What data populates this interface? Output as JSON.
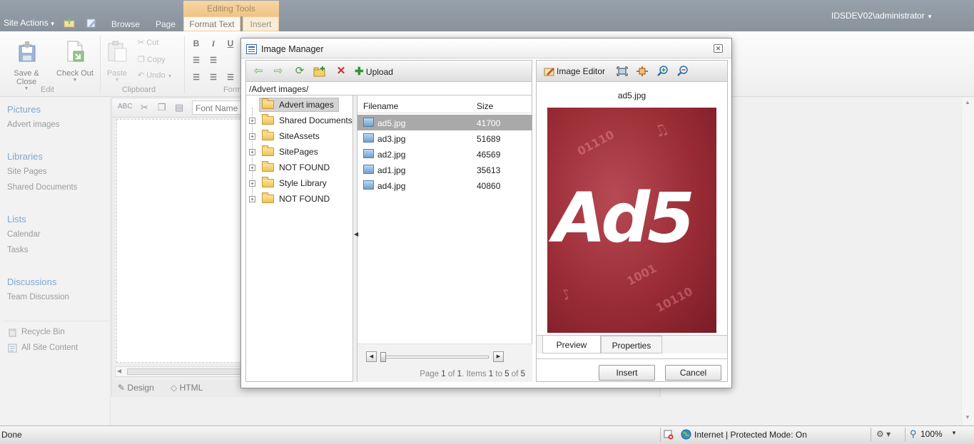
{
  "topbar": {
    "site_actions": "Site Actions",
    "tabs": {
      "browse": "Browse",
      "page": "Page",
      "format_text": "Format Text",
      "insert": "Insert"
    },
    "editing_tools": "Editing Tools",
    "user": "IDSDEV02\\administrator"
  },
  "ribbon": {
    "save_close": "Save & Close",
    "check_out": "Check Out",
    "edit_group": "Edit",
    "paste": "Paste",
    "cut": "Cut",
    "copy": "Copy",
    "undo": "Undo",
    "clipboard_group": "Clipboard",
    "format_group_partial": "Form",
    "bold": "B",
    "italic": "I",
    "underline": "U"
  },
  "leftnav": {
    "pictures": "Pictures",
    "advert_images": "Advert images",
    "libraries": "Libraries",
    "site_pages": "Site Pages",
    "shared_documents": "Shared Documents",
    "lists": "Lists",
    "calendar": "Calendar",
    "tasks": "Tasks",
    "discussions": "Discussions",
    "team_discussion": "Team Discussion",
    "recycle_bin": "Recycle Bin",
    "all_site_content": "All Site Content"
  },
  "editor": {
    "font_name": "Font Name",
    "design": "Design",
    "html": "HTML"
  },
  "dialog": {
    "title": "Image Manager",
    "upload": "Upload",
    "path": "/Advert images/",
    "tree": [
      {
        "label": "Advert images",
        "selected": true,
        "expandable": false
      },
      {
        "label": "Shared Documents",
        "selected": false,
        "expandable": true
      },
      {
        "label": "SiteAssets",
        "selected": false,
        "expandable": true
      },
      {
        "label": "SitePages",
        "selected": false,
        "expandable": true
      },
      {
        "label": "NOT FOUND",
        "selected": false,
        "expandable": true
      },
      {
        "label": "Style Library",
        "selected": false,
        "expandable": true
      },
      {
        "label": "NOT FOUND",
        "selected": false,
        "expandable": true
      }
    ],
    "file_headers": {
      "filename": "Filename",
      "size": "Size"
    },
    "files": [
      {
        "name": "ad5.jpg",
        "size": "41700",
        "selected": true
      },
      {
        "name": "ad3.jpg",
        "size": "51689",
        "selected": false
      },
      {
        "name": "ad2.jpg",
        "size": "46569",
        "selected": false
      },
      {
        "name": "ad1.jpg",
        "size": "35613",
        "selected": false
      },
      {
        "name": "ad4.jpg",
        "size": "40860",
        "selected": false
      }
    ],
    "pager": {
      "page_word": "Page",
      "page": "1",
      "of_word": "of",
      "pages": "1",
      "items_word": ". Items",
      "from": "1",
      "to_word": "to",
      "to": "5",
      "total": "5"
    },
    "image_editor": "Image Editor",
    "selected_name": "ad5.jpg",
    "preview_art_text": "Ad5",
    "preview_tab": "Preview",
    "properties_tab": "Properties",
    "insert_button": "Insert",
    "cancel_button": "Cancel"
  },
  "statusbar": {
    "done": "Done",
    "zone": "Internet | Protected Mode: On",
    "zoom": "100%"
  },
  "colors": {
    "accent_link": "#3d78b2",
    "editing_tools": "#e9a443",
    "preview_bg": "#9a2c36"
  }
}
